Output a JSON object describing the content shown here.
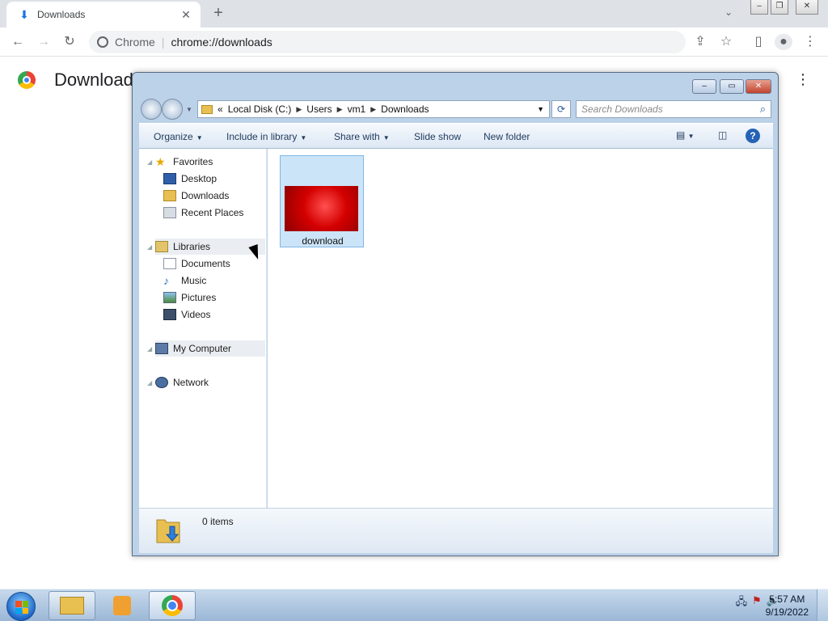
{
  "browser": {
    "tab_title": "Downloads",
    "tab_close": "✕",
    "new_tab": "+",
    "chip_label": "Chrome",
    "url": "chrome://downloads",
    "page_title": "Downloads"
  },
  "explorer": {
    "breadcrumb_prefix": "«",
    "breadcrumbs": [
      "Local Disk (C:)",
      "Users",
      "vm1",
      "Downloads"
    ],
    "search_placeholder": "Search Downloads",
    "commands": {
      "organize": "Organize",
      "include_library": "Include in library",
      "share_with": "Share with",
      "slide_show": "Slide show",
      "new_folder": "New folder"
    },
    "nav": {
      "favorites": "Favorites",
      "desktop": "Desktop",
      "downloads": "Downloads",
      "recent_places": "Recent Places",
      "libraries": "Libraries",
      "documents": "Documents",
      "music": "Music",
      "pictures": "Pictures",
      "videos": "Videos",
      "my_computer": "My Computer",
      "network": "Network"
    },
    "files": [
      {
        "name": "download",
        "type": "image"
      }
    ],
    "status": "0 items"
  },
  "taskbar": {
    "time": "5:57 AM",
    "date": "9/19/2022"
  },
  "colors": {
    "chrome_blue": "#1a73e8",
    "selection": "#cce4f7",
    "thumbnail_red": "#d40000"
  }
}
